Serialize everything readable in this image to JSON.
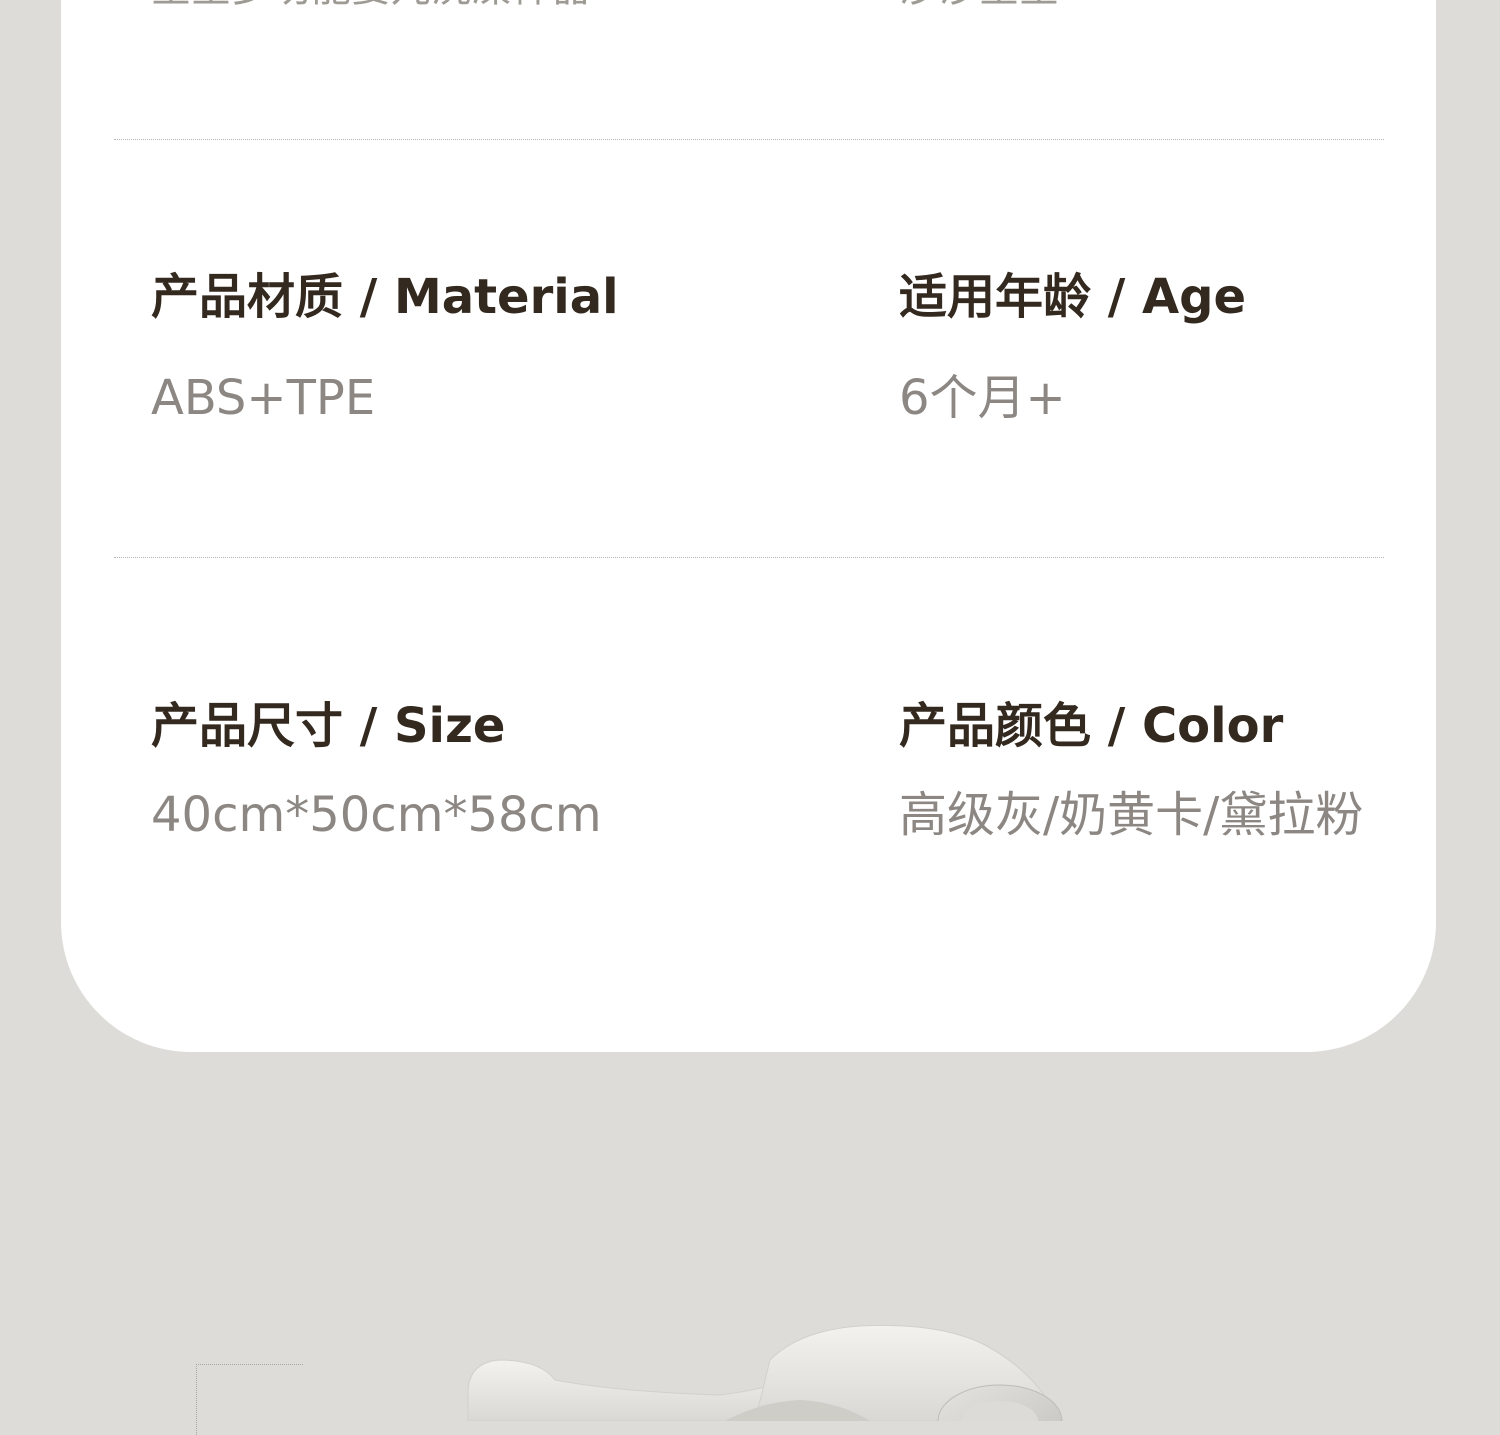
{
  "specs": {
    "top_cut": {
      "left": "宝宝多功能婴儿洗澡神器",
      "right": "沙沙宝宝"
    },
    "material": {
      "title": "产品材质 / Material",
      "value": "ABS+TPE"
    },
    "age": {
      "title": "适用年龄 / Age",
      "value": "6个月+"
    },
    "size": {
      "title": "产品尺寸 / Size",
      "value": "40cm*50cm*58cm"
    },
    "color": {
      "title": "产品颜色 / Color",
      "value": "高级灰/奶黄卡/黛拉粉"
    }
  },
  "colors": {
    "background": "#dddcd8",
    "card": "#ffffff",
    "title_text": "#33291f",
    "value_text": "#8c8782"
  }
}
